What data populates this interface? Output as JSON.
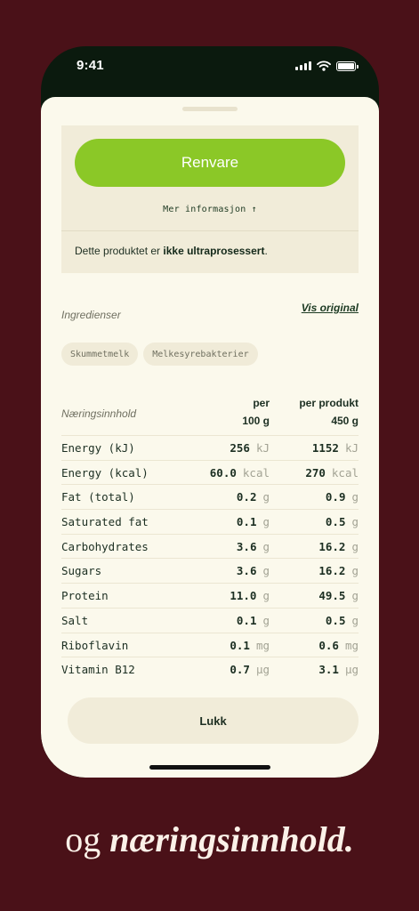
{
  "status": {
    "time": "9:41"
  },
  "card": {
    "primary_label": "Renvare",
    "more_info": "Mer informasjon ↑",
    "note_prefix": "Dette produktet er ",
    "note_bold": "ikke ultraprosessert",
    "note_suffix": "."
  },
  "ingredients": {
    "title": "Ingredienser",
    "link": "Vis original",
    "items": [
      "Skummetmelk",
      "Melkesyrebakterier"
    ]
  },
  "nutrition": {
    "title": "Næringsinnhold",
    "col1_line1": "per",
    "col1_line2": "100 g",
    "col2_line1": "per produkt",
    "col2_line2": "450 g",
    "rows": [
      {
        "name": "Energy (kJ)",
        "v1": "256",
        "u1": "kJ",
        "v2": "1152",
        "u2": "kJ"
      },
      {
        "name": "Energy (kcal)",
        "v1": "60.0",
        "u1": "kcal",
        "v2": "270",
        "u2": "kcal"
      },
      {
        "name": "Fat (total)",
        "v1": "0.2",
        "u1": "g",
        "v2": "0.9",
        "u2": "g"
      },
      {
        "name": "Saturated fat",
        "v1": "0.1",
        "u1": "g",
        "v2": "0.5",
        "u2": "g"
      },
      {
        "name": "Carbohydrates",
        "v1": "3.6",
        "u1": "g",
        "v2": "16.2",
        "u2": "g"
      },
      {
        "name": "Sugars",
        "v1": "3.6",
        "u1": "g",
        "v2": "16.2",
        "u2": "g"
      },
      {
        "name": "Protein",
        "v1": "11.0",
        "u1": "g",
        "v2": "49.5",
        "u2": "g"
      },
      {
        "name": "Salt",
        "v1": "0.1",
        "u1": "g",
        "v2": "0.5",
        "u2": "g"
      },
      {
        "name": "Riboflavin",
        "v1": "0.1",
        "u1": "mg",
        "v2": "0.6",
        "u2": "mg"
      },
      {
        "name": "Vitamin B12",
        "v1": "0.7",
        "u1": "µg",
        "v2": "3.1",
        "u2": "µg"
      }
    ]
  },
  "close_label": "Lukk",
  "caption": {
    "plain": "og ",
    "bold": "næringsinnhold."
  },
  "colors": {
    "accent": "#8bc827",
    "background": "#4a1118",
    "sheet": "#fbf9ec"
  },
  "icons": [
    "signal-icon",
    "wifi-icon",
    "battery-icon"
  ]
}
